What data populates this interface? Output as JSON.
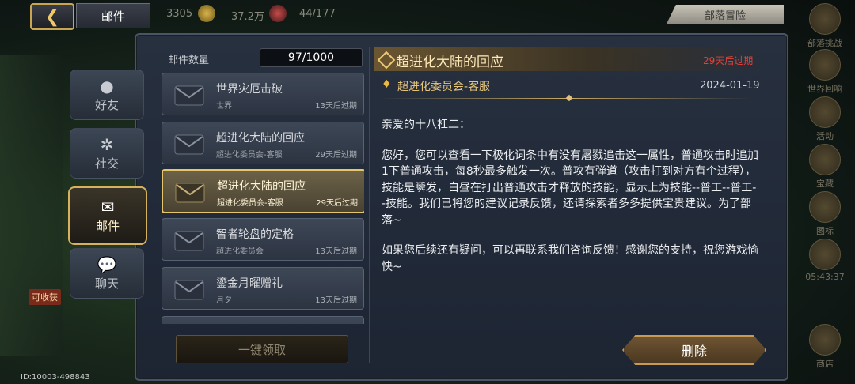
{
  "topbar": {
    "title": "邮件",
    "res1": "3305",
    "res2": "37.2万",
    "res3": "44/177",
    "tribe_btn": "部落冒险"
  },
  "right_sidebar": [
    "部落挑战",
    "世界回响",
    "活动",
    "宝藏",
    "图标",
    "05:43:37",
    "商店"
  ],
  "left": {
    "badge": "可收获",
    "id": "ID:10003-498843"
  },
  "tabs": [
    {
      "label": "好友",
      "icon": "person-icon"
    },
    {
      "label": "社交",
      "icon": "social-icon"
    },
    {
      "label": "邮件",
      "icon": "mail-icon"
    },
    {
      "label": "聊天",
      "icon": "chat-icon"
    }
  ],
  "mail_count": {
    "label": "邮件数量",
    "value": "97/1000"
  },
  "mails": [
    {
      "title": "世界灾厄击破",
      "sender": "世界",
      "expires": "13天后过期"
    },
    {
      "title": "超进化大陆的回应",
      "sender": "超进化委员会-客服",
      "expires": "29天后过期"
    },
    {
      "title": "超进化大陆的回应",
      "sender": "超进化委员会-客服",
      "expires": "29天后过期"
    },
    {
      "title": "智者轮盘的定格",
      "sender": "超进化委员会",
      "expires": "13天后过期"
    },
    {
      "title": "鎏金月曜赠礼",
      "sender": "月夕",
      "expires": "13天后过期"
    }
  ],
  "collect_all": "一键领取",
  "detail": {
    "title": "超进化大陆的回应",
    "expires": "29天后过期",
    "sender": "超进化委员会-客服",
    "date": "2024-01-19",
    "greeting": "亲爱的十八杠二：",
    "para1": "您好，您可以查看一下极化词条中有没有屠戮追击这一属性，普通攻击时追加1下普通攻击，每8秒最多触发一次。普攻有弹道（攻击打到对方有个过程），技能是瞬发，白昼在打出普通攻击才释放的技能，显示上为技能--普工--普工--技能。我们已将您的建议记录反馈，还请探索者多多提供宝贵建议。为了部落~",
    "para2": "如果您后续还有疑问，可以再联系我们咨询反馈！感谢您的支持，祝您游戏愉快~"
  },
  "delete": "删除"
}
